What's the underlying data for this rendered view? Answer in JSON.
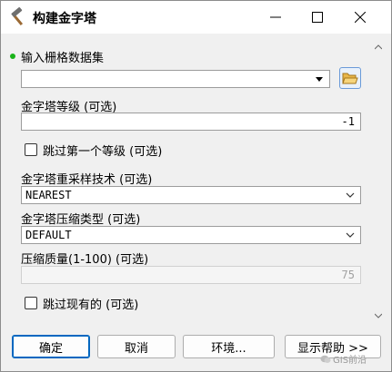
{
  "window": {
    "title": "构建金字塔"
  },
  "params": {
    "input": {
      "label": "输入栅格数据集",
      "value": ""
    },
    "levels": {
      "label": "金字塔等级 (可选)",
      "value": "-1"
    },
    "skip_first": {
      "label": "跳过第一个等级 (可选)",
      "checked": false
    },
    "resample": {
      "label": "金字塔重采样技术 (可选)",
      "value": "NEAREST"
    },
    "compress": {
      "label": "金字塔压缩类型 (可选)",
      "value": "DEFAULT"
    },
    "quality": {
      "label": "压缩质量(1-100) (可选)",
      "value": "75"
    },
    "skip_existing": {
      "label": "跳过现有的 (可选)",
      "checked": false
    }
  },
  "buttons": {
    "ok": "确定",
    "cancel": "取消",
    "env": "环境...",
    "help": "显示帮助 >>"
  },
  "watermark": "GIS前沿",
  "colors": {
    "required_dot": "#19b319",
    "accent": "#0067c0"
  }
}
